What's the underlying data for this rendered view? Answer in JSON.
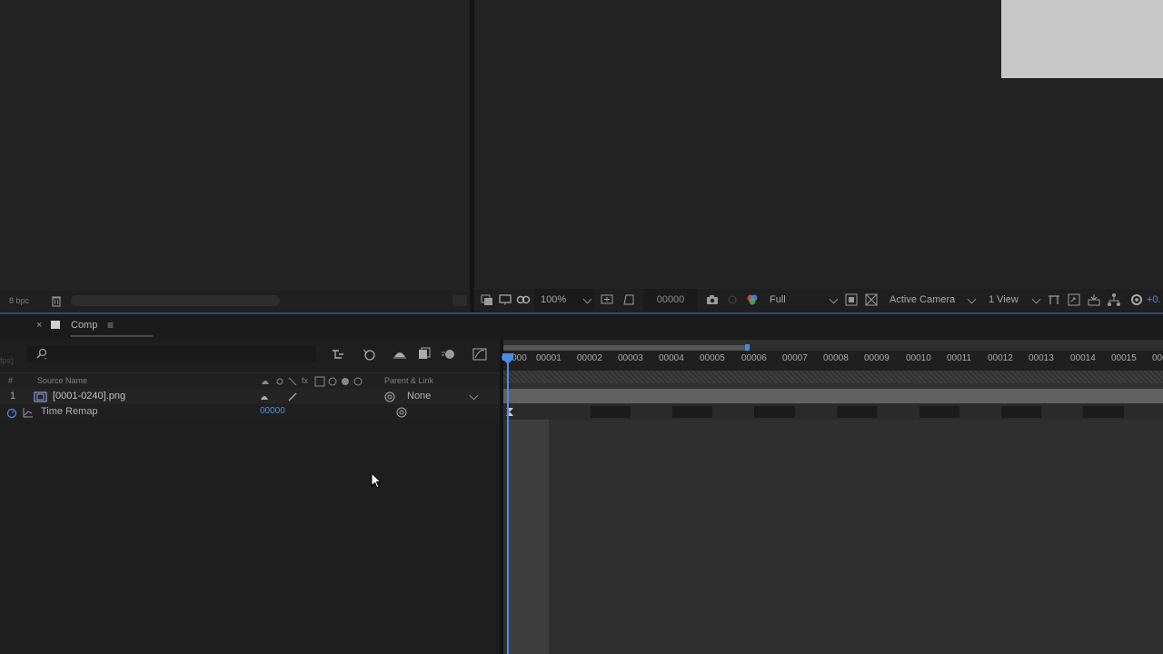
{
  "project_footer": {
    "bpc": "8 bpc"
  },
  "viewer_toolbar": {
    "zoom": "100%",
    "timecode": "00000",
    "resolution": "Full",
    "camera": "Active Camera",
    "views": "1 View",
    "exposure": "+0."
  },
  "timeline": {
    "tab_close": "×",
    "tab_label": "Comp",
    "tab_menu": "≡",
    "fps_label": "fps)",
    "columns": {
      "number": "#",
      "source_name": "Source Name",
      "switches": "fx",
      "parent": "Parent & Link"
    },
    "layer": {
      "index": "1",
      "name": "[0001-0240].png",
      "parent": "None"
    },
    "property": {
      "name": "Time Remap",
      "value": "00000"
    },
    "ruler_ticks": [
      "00000",
      "00001",
      "00002",
      "00003",
      "00004",
      "00005",
      "00006",
      "00007",
      "00008",
      "00009",
      "00010",
      "00011",
      "00012",
      "00013",
      "00014",
      "00015",
      "000"
    ]
  },
  "colors": {
    "accent_blue": "#4a8ce6",
    "panel_bg": "#232323",
    "timeline_bg": "#2f2f2f"
  }
}
